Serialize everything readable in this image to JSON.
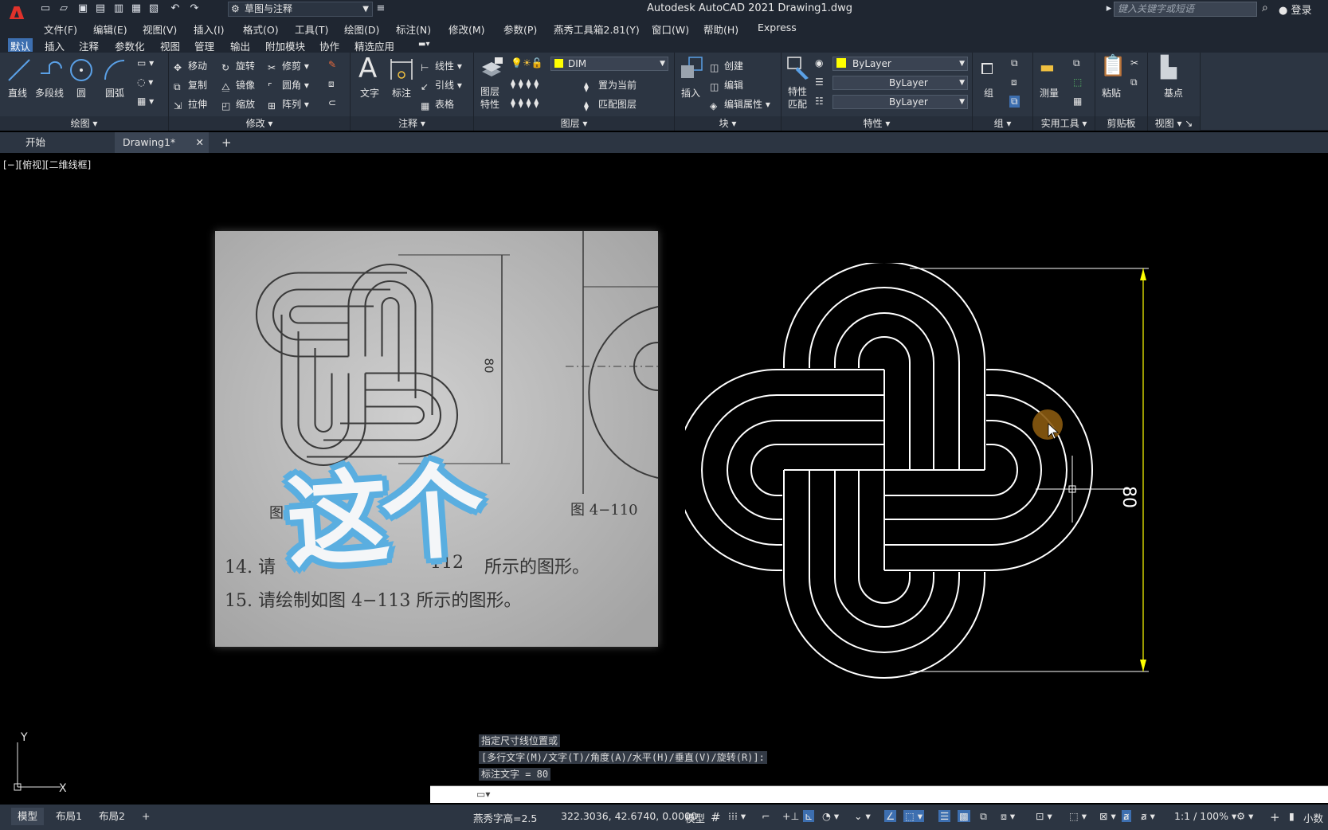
{
  "titlebar": {
    "workspace": "草图与注释",
    "title": "Autodesk AutoCAD 2021    Drawing1.dwg",
    "search_placeholder": "键入关键字或短语",
    "login": "登录"
  },
  "menu": [
    "文件(F)",
    "编辑(E)",
    "视图(V)",
    "插入(I)",
    "格式(O)",
    "工具(T)",
    "绘图(D)",
    "标注(N)",
    "修改(M)",
    "参数(P)",
    "燕秀工具箱2.81(Y)",
    "窗口(W)",
    "帮助(H)",
    "Express"
  ],
  "ribbon_tabs": [
    "默认",
    "插入",
    "注释",
    "参数化",
    "视图",
    "管理",
    "输出",
    "附加模块",
    "协作",
    "精选应用"
  ],
  "ribbon": {
    "draw": {
      "title": "绘图",
      "line": "直线",
      "polyline": "多段线",
      "circle": "圆",
      "arc": "圆弧"
    },
    "modify": {
      "title": "修改",
      "move": "移动",
      "rotate": "旋转",
      "trim": "修剪",
      "copy": "复制",
      "mirror": "镜像",
      "fillet": "圆角",
      "stretch": "拉伸",
      "scale": "缩放",
      "array": "阵列"
    },
    "annotation": {
      "title": "注释",
      "text": "文字",
      "dimension": "标注",
      "linear": "线性",
      "leader": "引线",
      "table": "表格"
    },
    "layers": {
      "title": "图层",
      "properties_1": "图层",
      "properties_2": "特性",
      "current_layer": "DIM",
      "set_current": "置为当前",
      "match_layer": "匹配图层"
    },
    "block": {
      "title": "块",
      "insert": "插入",
      "create": "创建",
      "edit": "编辑",
      "edit_attr": "编辑属性"
    },
    "properties": {
      "title": "特性",
      "match_1": "特性",
      "match_2": "匹配",
      "color": "ByLayer",
      "linetype": "ByLayer",
      "lineweight": "ByLayer"
    },
    "groups": {
      "title": "组",
      "group": "组"
    },
    "utilities": {
      "title": "实用工具",
      "measure": "测量"
    },
    "clipboard": {
      "title": "剪贴板",
      "paste": "粘贴"
    },
    "view": {
      "title": "视图",
      "base": "基点"
    }
  },
  "doc_tabs": {
    "start": "开始",
    "drawing": "Drawing1*",
    "close": "✕",
    "new": "+"
  },
  "viewport_label": "[−][俯视][二维线框]",
  "photo": {
    "dim": "80",
    "fig_left": "图",
    "fig_right": "图 4−110",
    "line14": "14.  请",
    "line14b": "所示的图形。",
    "line14n": "112",
    "line15": "15.  请绘制如图 4−113 所示的图形。",
    "overlay": "这个"
  },
  "dimension": {
    "value": "80"
  },
  "command": {
    "line1": "指定尺寸线位置或",
    "line2": "[多行文字(M)/文字(T)/角度(A)/水平(H)/垂直(V)/旋转(R)]:",
    "line3": "标注文字 = 80",
    "input_value": ""
  },
  "status": {
    "layouts": [
      "模型",
      "布局1",
      "布局2"
    ],
    "add_layout": "+",
    "text_height": "燕秀字高=2.5",
    "coords": "322.3036, 42.6740, 0.0000",
    "mode": "模型",
    "scale": "1:1 / 100%",
    "units": "小数"
  },
  "colors": {
    "accent": "#3d6fb0",
    "ribbon": "#2c3542",
    "dim": "#ffff00",
    "layer_color": "#ffff00"
  }
}
